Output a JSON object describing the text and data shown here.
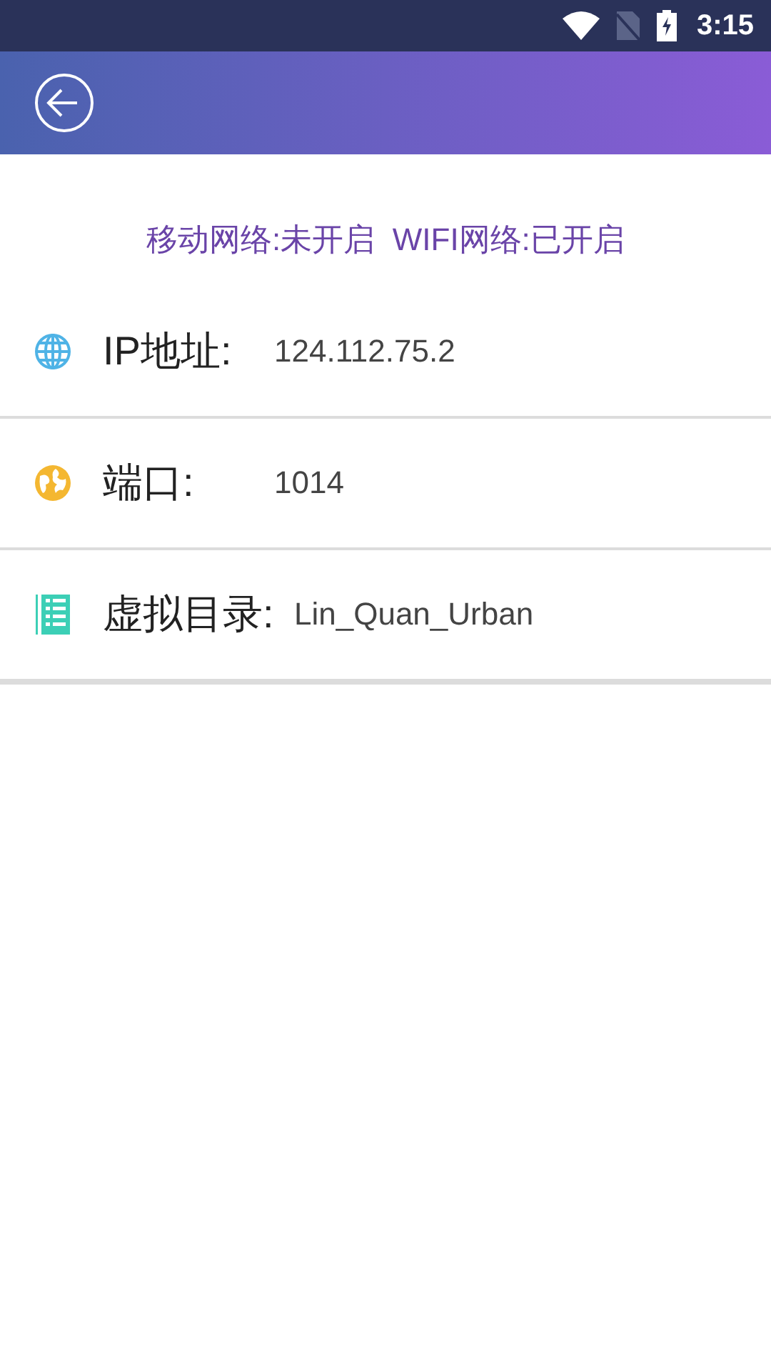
{
  "status_bar": {
    "time": "3:15"
  },
  "network_status": "移动网络:未开启  WIFI网络:已开启",
  "rows": [
    {
      "kind": "globe",
      "label": "IP地址:",
      "value": "124.112.75.2"
    },
    {
      "kind": "earth",
      "label": "端口:",
      "value": "1014"
    },
    {
      "kind": "list",
      "label": "虚拟目录:",
      "value": "Lin_Quan_Urban"
    }
  ]
}
